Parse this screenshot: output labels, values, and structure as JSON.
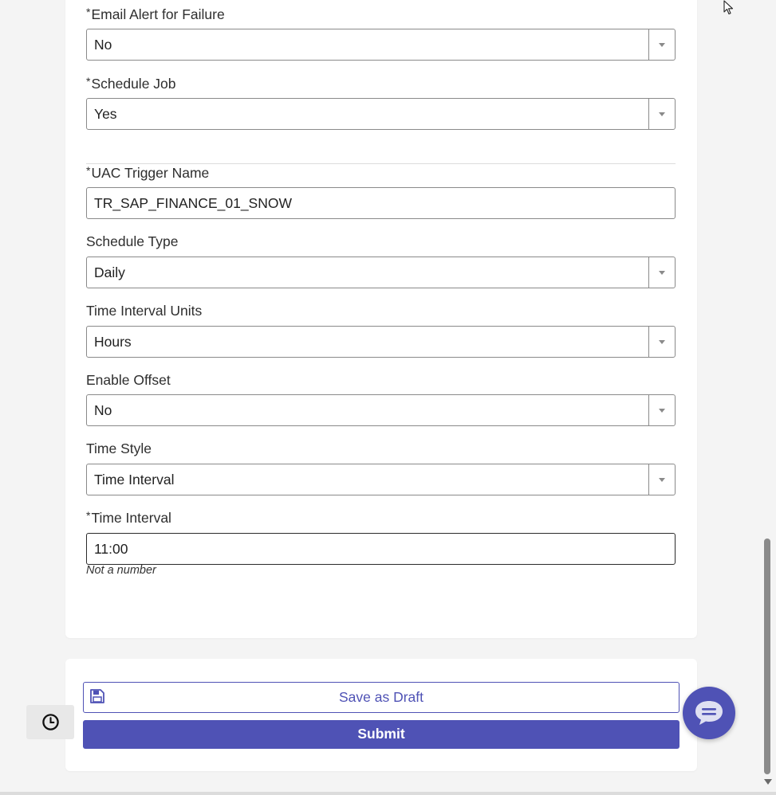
{
  "form": {
    "email_alert": {
      "required_mark": "*",
      "label": "Email Alert for Failure",
      "value": "No"
    },
    "schedule_job": {
      "required_mark": "*",
      "label": "Schedule Job",
      "value": "Yes"
    },
    "uac_trigger_name": {
      "required_mark": "*",
      "label": "UAC Trigger Name",
      "value": "TR_SAP_FINANCE_01_SNOW"
    },
    "schedule_type": {
      "label": "Schedule Type",
      "value": "Daily"
    },
    "time_interval_units": {
      "label": "Time Interval Units",
      "value": "Hours"
    },
    "enable_offset": {
      "label": "Enable Offset",
      "value": "No"
    },
    "time_style": {
      "label": "Time Style",
      "value": "Time Interval"
    },
    "time_interval": {
      "required_mark": "*",
      "label": "Time Interval",
      "value": "11:00",
      "error": "Not a number"
    }
  },
  "actions": {
    "save_draft_label": "Save as Draft",
    "submit_label": "Submit"
  },
  "colors": {
    "accent": "#4f52b5",
    "border": "#8a8a8a",
    "background": "#f4f4f4"
  },
  "icons": {
    "save": "floppy-disk-icon",
    "history": "clock-icon",
    "chat": "chat-bubble-icon",
    "cursor": "mouse-pointer-icon"
  }
}
